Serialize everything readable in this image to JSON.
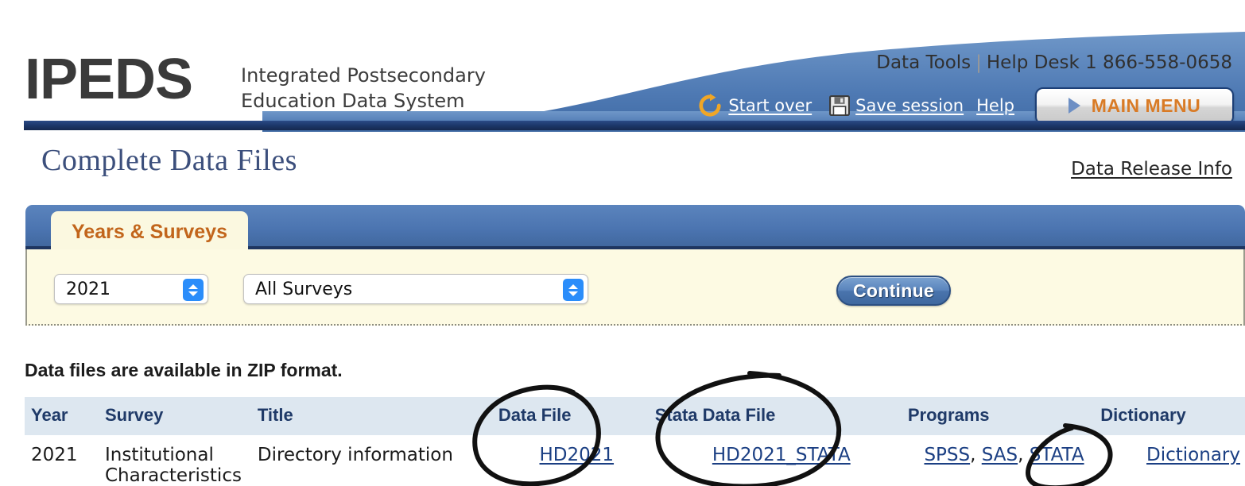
{
  "header": {
    "logo_main": "IPEDS",
    "logo_sub_line1": "Integrated Postsecondary",
    "logo_sub_line2": "Education Data System",
    "data_tools": "Data Tools",
    "separator": "|",
    "help_desk": "Help Desk 1 866-558-0658",
    "start_over": "Start over",
    "save_session": "Save session",
    "help": "Help",
    "main_menu": "MAIN MENU",
    "reload_icon": "reload-icon",
    "save_icon": "floppy-disk-icon",
    "triangle_icon": "play-triangle-icon"
  },
  "page": {
    "title": "Complete Data Files",
    "release_info": "Data Release Info"
  },
  "panel": {
    "tab_label": "Years & Surveys",
    "year_value": "2021",
    "survey_value": "All Surveys",
    "continue_label": "Continue"
  },
  "note": "Data files are available in ZIP format.",
  "table": {
    "columns": [
      "Year",
      "Survey",
      "Title",
      "Data File",
      "Stata Data File",
      "Programs",
      "Dictionary"
    ],
    "rows": [
      {
        "year": "2021",
        "survey_line1": "Institutional",
        "survey_line2": "Characteristics",
        "title": "Directory information",
        "data_file": "HD2021",
        "stata_data_file": "HD2021_STATA",
        "programs": [
          "SPSS",
          "SAS",
          "STATA"
        ],
        "programs_sep": ", ",
        "dictionary": "Dictionary"
      }
    ]
  },
  "annotations": {
    "circle_data_file": "hand-drawn circle around Data File column / HD2021 link",
    "circle_stata_data_file": "hand-drawn circle around Stata Data File column / HD2021_STATA link",
    "circle_stata_program": "hand-drawn circle around STATA program link"
  },
  "colors": {
    "brand_navy": "#1b3567",
    "brand_blue": "#4b74b0",
    "accent_orange": "#c2651b",
    "panel_cream": "#fdfae3",
    "table_header": "#dde7f0",
    "link_blue": "#1b3f83",
    "annotation_ink": "#111111"
  }
}
